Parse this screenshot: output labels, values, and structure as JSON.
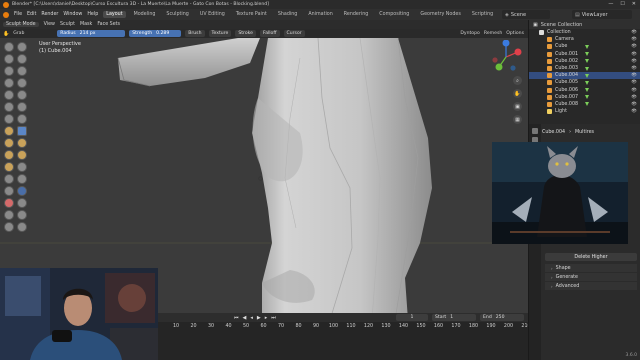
{
  "titlebar": {
    "title": "Blender* [C:\\Users\\daniel\\Desktop\\Curso Escultura 3D - La Muerte\\La Muerte - Gato Con Botas - Blocking.blend]",
    "minimize": "—",
    "maximize": "☐",
    "close": "✕"
  },
  "menubar": {
    "menus": [
      "File",
      "Edit",
      "Render",
      "Window",
      "Help"
    ],
    "workspaces": [
      "Layout",
      "Modeling",
      "Sculpting",
      "UV Editing",
      "Texture Paint",
      "Shading",
      "Animation",
      "Rendering",
      "Compositing",
      "Geometry Nodes",
      "Scripting"
    ],
    "active_workspace": "Layout",
    "scene_label": "Scene",
    "viewlayer_label": "ViewLayer"
  },
  "viewport_header": {
    "mode": "Sculpt Mode",
    "items": [
      "View",
      "Sculpt",
      "Mask",
      "Face Sets"
    ]
  },
  "tool_header": {
    "tool": "Grab",
    "radius_label": "Radius",
    "radius_value": "214 px",
    "strength_label": "Strength",
    "strength_value": "0.289",
    "dropdowns": [
      "Brush",
      "Texture",
      "Stroke",
      "Falloff",
      "Cursor"
    ],
    "dyntopo": "Dyntopo",
    "remesh": "Remesh",
    "options": "Options"
  },
  "viewport": {
    "view_name": "User Perspective",
    "object_name": "(1) Cube.004",
    "bg_color": "#3c3c3c",
    "mesh_color": "#c9c9c9"
  },
  "outliner": {
    "header": "Scene Collection",
    "rows": [
      {
        "label": "Collection",
        "sel": false,
        "icon": "collection-icon"
      },
      {
        "label": "Camera",
        "sel": false,
        "icon": "camera-icon"
      },
      {
        "label": "Cube",
        "sel": false,
        "icon": "mesh-icon"
      },
      {
        "label": "Cube.001",
        "sel": false,
        "icon": "mesh-icon"
      },
      {
        "label": "Cube.002",
        "sel": false,
        "icon": "mesh-icon"
      },
      {
        "label": "Cube.003",
        "sel": false,
        "icon": "mesh-icon"
      },
      {
        "label": "Cube.004",
        "sel": true,
        "icon": "mesh-icon"
      },
      {
        "label": "Cube.005",
        "sel": false,
        "icon": "mesh-icon"
      },
      {
        "label": "Cube.006",
        "sel": false,
        "icon": "mesh-icon"
      },
      {
        "label": "Cube.007",
        "sel": false,
        "icon": "mesh-icon"
      },
      {
        "label": "Cube.008",
        "sel": false,
        "icon": "mesh-icon"
      },
      {
        "label": "Light",
        "sel": false,
        "icon": "light-icon"
      }
    ]
  },
  "properties": {
    "object": "Cube.004",
    "modifier": "Multires",
    "delete_button": "Delete Higher",
    "panels": [
      "Shape",
      "Generate",
      "Advanced"
    ]
  },
  "timeline": {
    "current_frame": "1",
    "start_label": "Start",
    "start_value": "1",
    "end_label": "End",
    "end_value": "250",
    "ticks": [
      "10",
      "20",
      "30",
      "40",
      "50",
      "60",
      "70",
      "80",
      "90",
      "100",
      "110",
      "120",
      "130",
      "140",
      "150",
      "160",
      "170",
      "180",
      "190",
      "200",
      "210",
      "220",
      "230",
      "240",
      "250"
    ]
  },
  "version": "3.6.0"
}
